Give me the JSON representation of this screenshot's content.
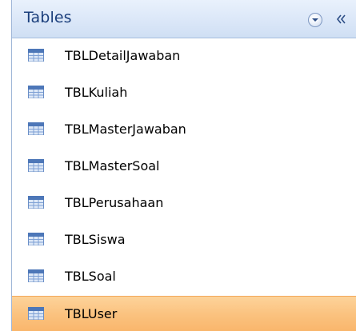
{
  "pane": {
    "title": "Tables",
    "dropdown_icon": "chevron-down-icon",
    "collapse_icon": "double-chevron-left-icon",
    "collapse_glyph": "«"
  },
  "tables": [
    {
      "label": "TBLDetailJawaban",
      "icon": "table-icon",
      "selected": false
    },
    {
      "label": "TBLKuliah",
      "icon": "table-icon",
      "selected": false
    },
    {
      "label": "TBLMasterJawaban",
      "icon": "table-icon",
      "selected": false
    },
    {
      "label": "TBLMasterSoal",
      "icon": "table-icon",
      "selected": false
    },
    {
      "label": "TBLPerusahaan",
      "icon": "table-icon",
      "selected": false
    },
    {
      "label": "TBLSiswa",
      "icon": "table-icon",
      "selected": false
    },
    {
      "label": "TBLSoal",
      "icon": "table-icon",
      "selected": false
    },
    {
      "label": "TBLUser",
      "icon": "table-icon",
      "selected": true
    }
  ],
  "colors": {
    "header_text": "#1b3f7c",
    "selected_bg": "#fbc27f",
    "icon_header": "#4d77b8",
    "icon_grid": "#ffffff"
  }
}
